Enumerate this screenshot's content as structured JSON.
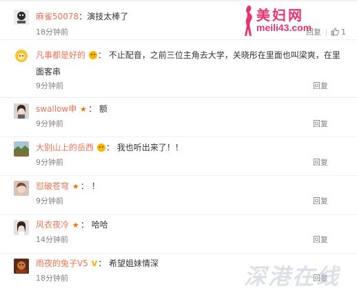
{
  "comments": [
    {
      "user": "麻雀50078",
      "colon": "：",
      "text": "演技太棒了",
      "time": "18分钟前",
      "reply": "回复",
      "likes": "1",
      "avatar_color": "#ececec"
    },
    {
      "user": "凡事都是好的",
      "colon": "：",
      "text": "不止配音，之前三位主角去大学，关晓彤在里面也叫梁爽，在里面客串",
      "time": "9分钟前",
      "reply": "回复",
      "avatar_color": "#f6d24a"
    },
    {
      "user": "swallow申",
      "colon": "：",
      "text": "额",
      "time": "9分钟前",
      "reply": "回复",
      "avatar_color": "#9a8c86"
    },
    {
      "user": "大别山上的岳西",
      "colon": "：",
      "text": "我也听出来了！！",
      "time": "9分钟前",
      "reply": "回复",
      "avatar_color": "#7e9a5a"
    },
    {
      "user": "怼破苍穹",
      "colon": "：",
      "text": "！",
      "time": "9分钟前",
      "reply": "回复",
      "avatar_color": "#b08a7a"
    },
    {
      "user": "风衣夜冷",
      "colon": "：",
      "text": "哈哈",
      "time": "14分钟前",
      "reply": "回复",
      "avatar_color": "#c9c4c0"
    },
    {
      "user": "雨夜的兔子V5",
      "colon": "：",
      "text": "希望姐妹情深",
      "time": "18分钟前",
      "reply": "回复",
      "avatar_color": "#a85a32"
    }
  ],
  "watermark_top": {
    "title": "美妇网",
    "url": "meili43.com"
  },
  "watermark_bottom": {
    "text": "深港在线"
  },
  "colors": {
    "username": "#eb7350",
    "meta": "#808080",
    "badge_star": "#ff6a00",
    "badge_v": "#ffa800",
    "watermark_pink": "#e8336f"
  }
}
